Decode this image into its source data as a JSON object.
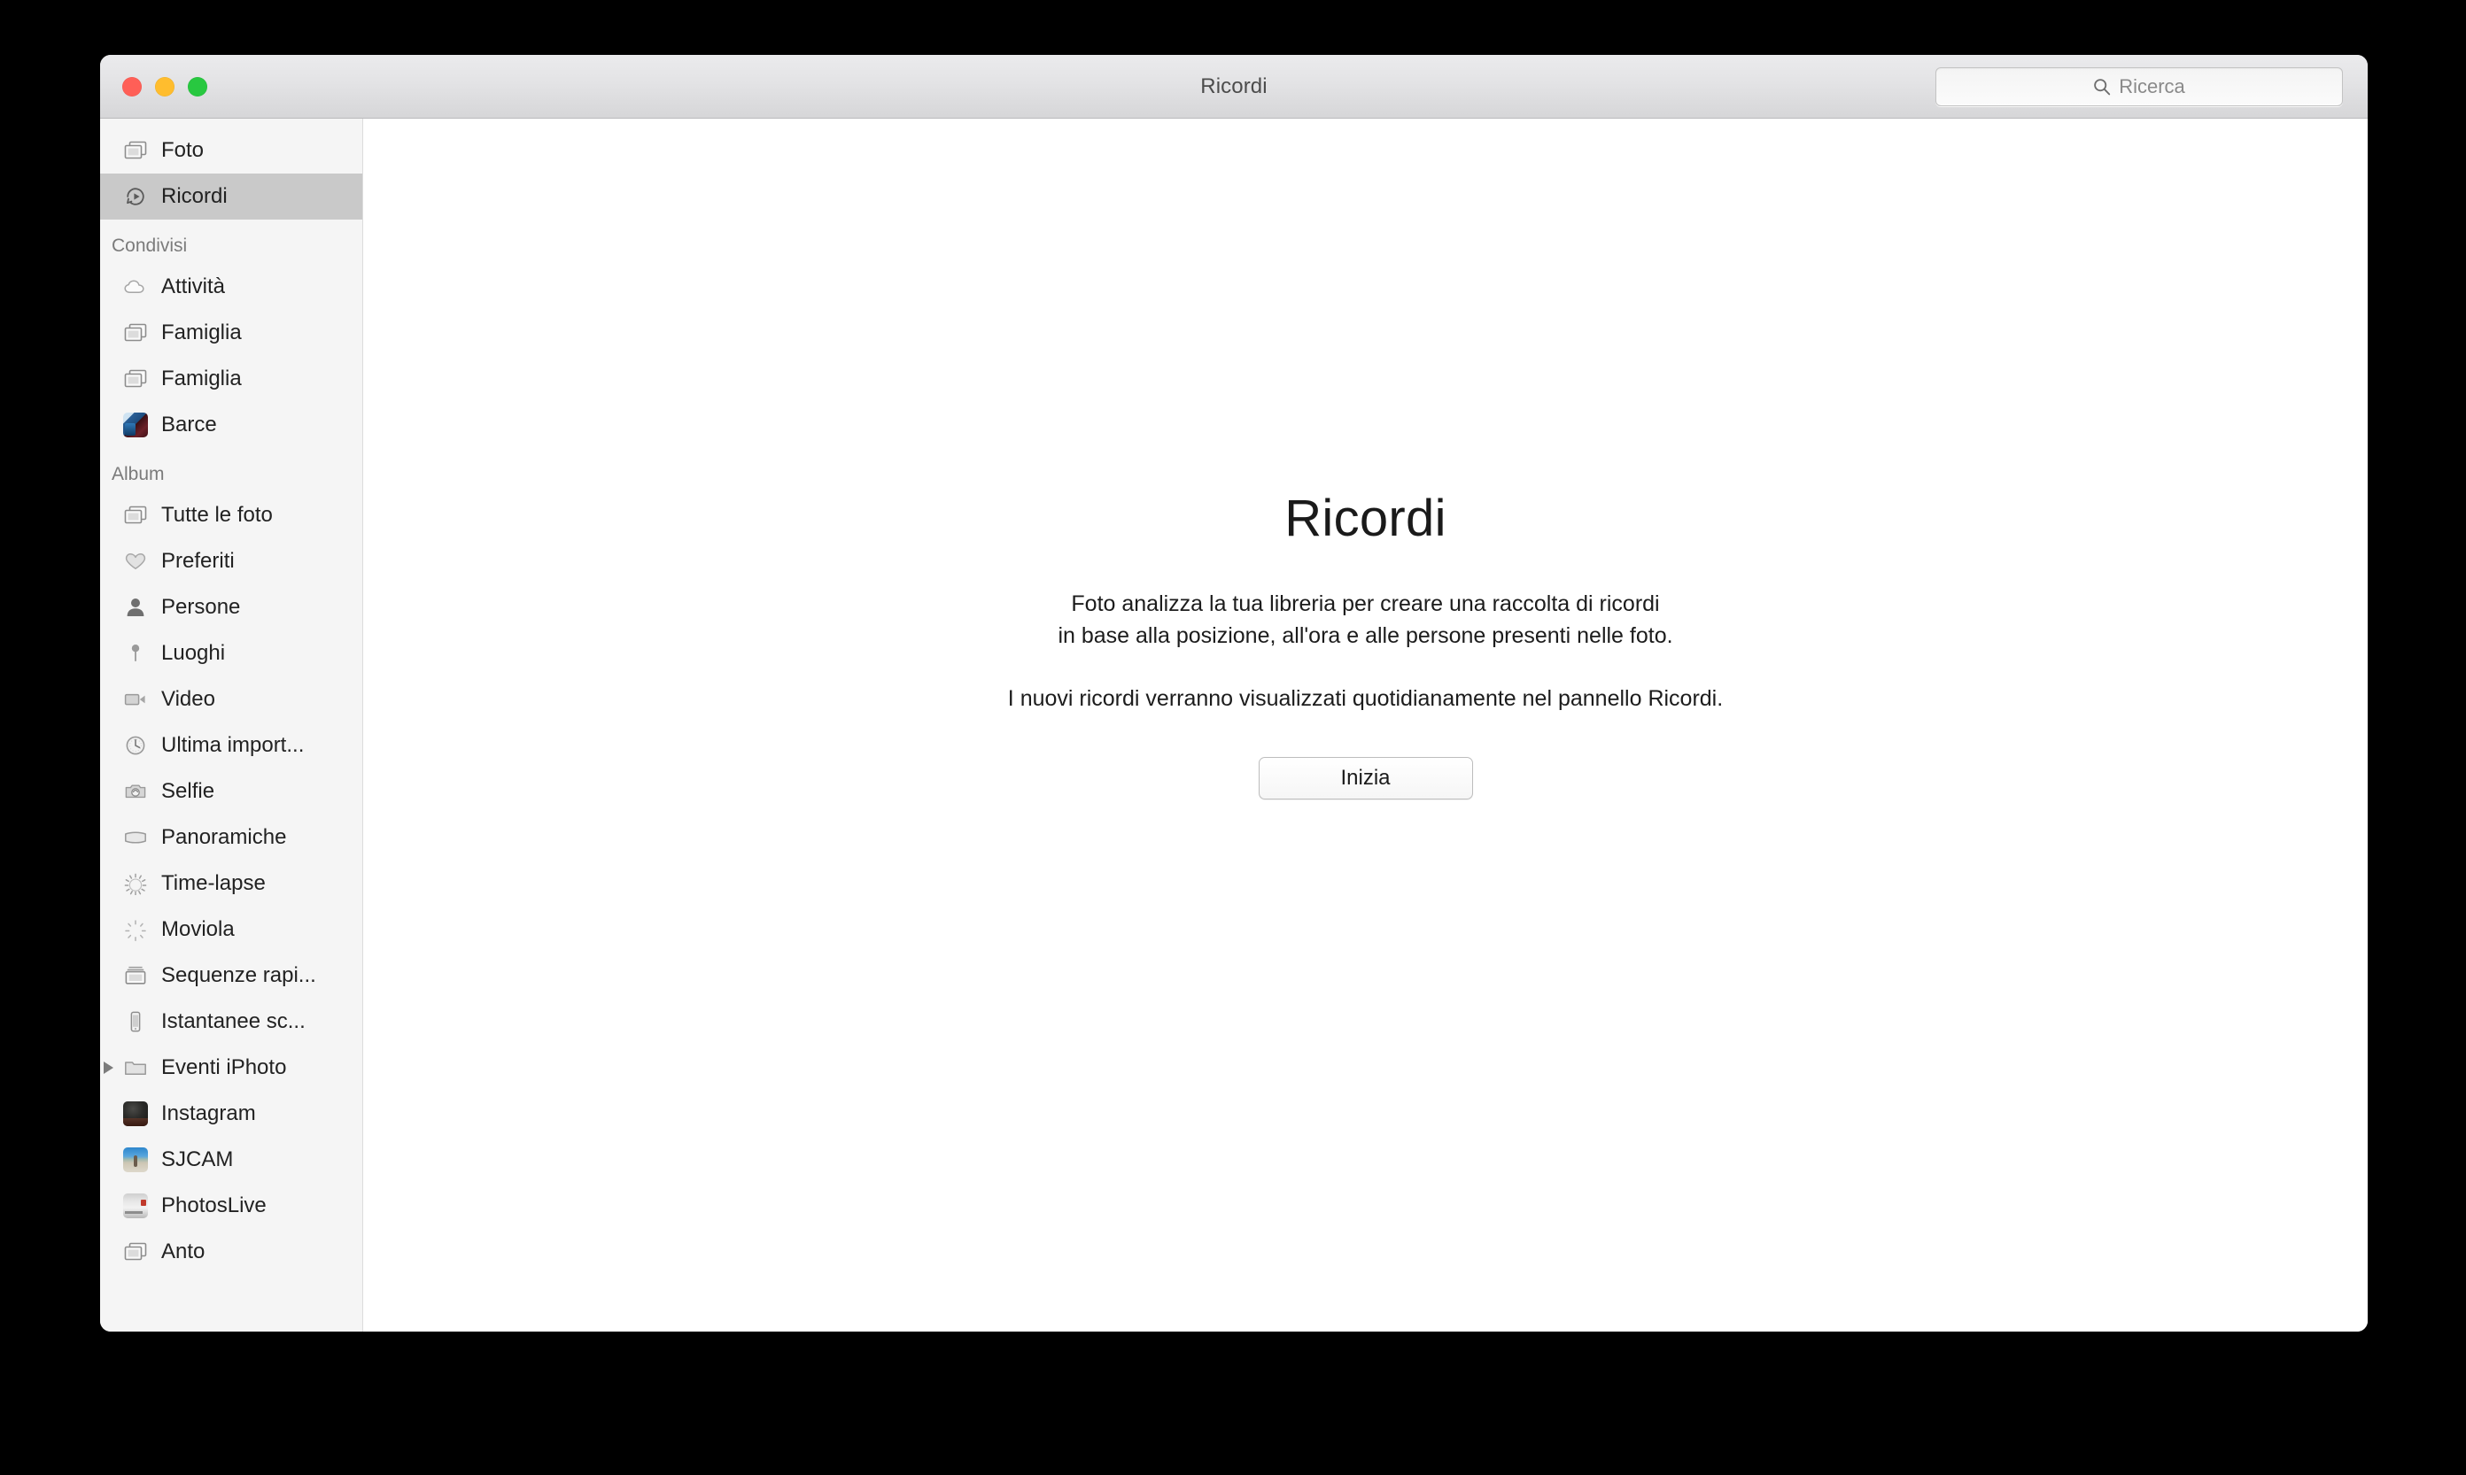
{
  "window": {
    "title": "Ricordi",
    "traffic_lights": [
      {
        "name": "close",
        "color": "#ff5f57"
      },
      {
        "name": "minimize",
        "color": "#ffbd2e"
      },
      {
        "name": "zoom",
        "color": "#28c840"
      }
    ]
  },
  "search": {
    "placeholder": "Ricerca",
    "value": "",
    "icon": "search-icon"
  },
  "sidebar": {
    "top_items": [
      {
        "label": "Foto",
        "icon": "photos-stack-icon",
        "selected": false
      },
      {
        "label": "Ricordi",
        "icon": "memories-rewind-icon",
        "selected": true
      }
    ],
    "sections": [
      {
        "header": "Condivisi",
        "items": [
          {
            "label": "Attività",
            "icon": "cloud-icon",
            "kind": "glyph"
          },
          {
            "label": "Famiglia",
            "icon": "photos-stack-icon",
            "kind": "glyph"
          },
          {
            "label": "Famiglia",
            "icon": "photos-stack-icon",
            "kind": "glyph"
          },
          {
            "label": "Barce",
            "icon": "album-thumbnail-boat",
            "kind": "thumb",
            "thumb_class": "thumb-boat"
          }
        ]
      },
      {
        "header": "Album",
        "items": [
          {
            "label": "Tutte le foto",
            "icon": "photos-stack-icon",
            "kind": "glyph"
          },
          {
            "label": "Preferiti",
            "icon": "heart-icon",
            "kind": "glyph"
          },
          {
            "label": "Persone",
            "icon": "person-icon",
            "kind": "glyph"
          },
          {
            "label": "Luoghi",
            "icon": "map-pin-icon",
            "kind": "glyph"
          },
          {
            "label": "Video",
            "icon": "video-camera-icon",
            "kind": "glyph"
          },
          {
            "label": "Ultima import...",
            "icon": "clock-icon",
            "kind": "glyph"
          },
          {
            "label": "Selfie",
            "icon": "camera-rotate-icon",
            "kind": "glyph"
          },
          {
            "label": "Panoramiche",
            "icon": "panorama-icon",
            "kind": "glyph"
          },
          {
            "label": "Time-lapse",
            "icon": "time-lapse-icon",
            "kind": "glyph"
          },
          {
            "label": "Moviola",
            "icon": "slow-motion-icon",
            "kind": "glyph"
          },
          {
            "label": "Sequenze rapi...",
            "icon": "burst-stack-icon",
            "kind": "glyph"
          },
          {
            "label": "Istantanee sc...",
            "icon": "iphone-icon",
            "kind": "glyph"
          },
          {
            "label": "Eventi iPhoto",
            "icon": "folder-icon",
            "kind": "glyph",
            "disclosure": true
          },
          {
            "label": "Instagram",
            "icon": "album-thumbnail-dark",
            "kind": "thumb",
            "thumb_class": "thumb-dark"
          },
          {
            "label": "SJCAM",
            "icon": "album-thumbnail-beach",
            "kind": "thumb",
            "thumb_class": "thumb-beach"
          },
          {
            "label": "PhotosLive",
            "icon": "album-thumbnail-van",
            "kind": "thumb",
            "thumb_class": "thumb-van"
          },
          {
            "label": "Anto",
            "icon": "photos-stack-icon",
            "kind": "glyph"
          }
        ]
      }
    ]
  },
  "main": {
    "title": "Ricordi",
    "paragraph_1": "Foto analizza la tua libreria per creare una raccolta di ricordi\nin base alla posizione, all'ora e alle persone presenti nelle foto.",
    "paragraph_2": "I nuovi ricordi verranno visualizzati quotidianamente nel pannello Ricordi.",
    "start_button": "Inizia"
  },
  "colors": {
    "sidebar_bg": "#f5f5f5",
    "selection": "#c9c9c9",
    "titlebar_top": "#ebebed",
    "titlebar_bottom": "#d6d6d8",
    "content_bg": "#ffffff",
    "text": "#222222",
    "section_header": "#7b7b7b"
  }
}
